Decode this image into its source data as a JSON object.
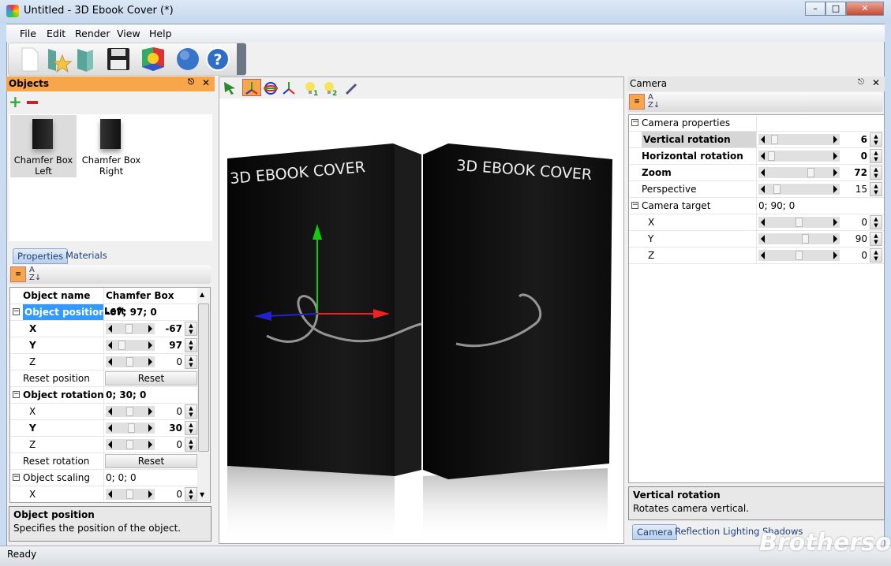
{
  "window": {
    "title": "Untitled - 3D Ebook Cover (*)",
    "controls": [
      "minimize",
      "maximize",
      "close"
    ]
  },
  "menu": [
    "File",
    "Edit",
    "Render",
    "View",
    "Help"
  ],
  "toolbar": [
    "new-icon",
    "open-favorite-icon",
    "open-icon",
    "save-icon",
    "render-icon",
    "web-icon",
    "help-icon"
  ],
  "objects_panel": {
    "title": "Objects",
    "items": [
      {
        "label": "Chamfer Box Left",
        "selected": true
      },
      {
        "label": "Chamfer Box Right",
        "selected": false
      }
    ]
  },
  "left_tabs": [
    "Properties",
    "Materials"
  ],
  "properties": {
    "rows": [
      {
        "name": "Object name",
        "value": "Chamfer Box Left",
        "bold": true,
        "type": "text"
      },
      {
        "name": "Object position",
        "value": "-67; 97; 0",
        "bold": true,
        "type": "group",
        "selected": true
      },
      {
        "name": "X",
        "value": "-67",
        "bold": true,
        "type": "slider",
        "level": 0.45
      },
      {
        "name": "Y",
        "value": "97",
        "bold": true,
        "type": "slider",
        "level": 0.15
      },
      {
        "name": "Z",
        "value": "0",
        "bold": false,
        "type": "slider",
        "level": 0.5
      },
      {
        "name": "Reset position",
        "value": "Reset",
        "bold": false,
        "type": "button"
      },
      {
        "name": "Object rotation",
        "value": "0; 30; 0",
        "bold": true,
        "type": "group"
      },
      {
        "name": "X",
        "value": "0",
        "bold": false,
        "type": "slider",
        "level": 0.5
      },
      {
        "name": "Y",
        "value": "30",
        "bold": true,
        "type": "slider",
        "level": 0.58
      },
      {
        "name": "Z",
        "value": "0",
        "bold": false,
        "type": "slider",
        "level": 0.5
      },
      {
        "name": "Reset rotation",
        "value": "Reset",
        "bold": false,
        "type": "button"
      },
      {
        "name": "Object scaling",
        "value": "0; 0; 0",
        "bold": false,
        "type": "group"
      },
      {
        "name": "X",
        "value": "0",
        "bold": false,
        "type": "slider",
        "level": 0.5
      }
    ],
    "description_title": "Object position",
    "description_text": "Specifies the position of the object."
  },
  "viewport": {
    "tools": [
      "select-icon",
      "move-icon",
      "rotate-icon",
      "scale-icon",
      "light-1-icon",
      "light-2-icon",
      "eyedropper-icon"
    ],
    "cover_text": "3D EBOOK COVER"
  },
  "camera": {
    "title": "Camera",
    "rows": [
      {
        "name": "Camera properties",
        "value": "",
        "type": "group"
      },
      {
        "name": "Vertical rotation",
        "value": "6",
        "bold": true,
        "type": "slider",
        "level": 0.06,
        "selected": true
      },
      {
        "name": "Horizontal rotation",
        "value": "0",
        "bold": true,
        "type": "slider",
        "level": 0.0
      },
      {
        "name": "Zoom",
        "value": "72",
        "bold": true,
        "type": "slider",
        "level": 0.72
      },
      {
        "name": "Perspective",
        "value": "15",
        "bold": false,
        "type": "slider",
        "level": 0.1
      },
      {
        "name": "Camera target",
        "value": "0; 90; 0",
        "type": "group"
      },
      {
        "name": "X",
        "value": "0",
        "bold": false,
        "type": "slider",
        "level": 0.5
      },
      {
        "name": "Y",
        "value": "90",
        "bold": false,
        "type": "slider",
        "level": 0.62
      },
      {
        "name": "Z",
        "value": "0",
        "bold": false,
        "type": "slider",
        "level": 0.5
      }
    ],
    "description_title": "Vertical rotation",
    "description_text": "Rotates camera vertical."
  },
  "right_tabs": [
    "Camera",
    "Reflection",
    "Lighting",
    "Shadows"
  ],
  "status": "Ready",
  "watermark": "Brothersoft",
  "colors": {
    "panel_header": "#f9a54a",
    "selection": "#3399ff",
    "accent": "#1c3f7a"
  }
}
